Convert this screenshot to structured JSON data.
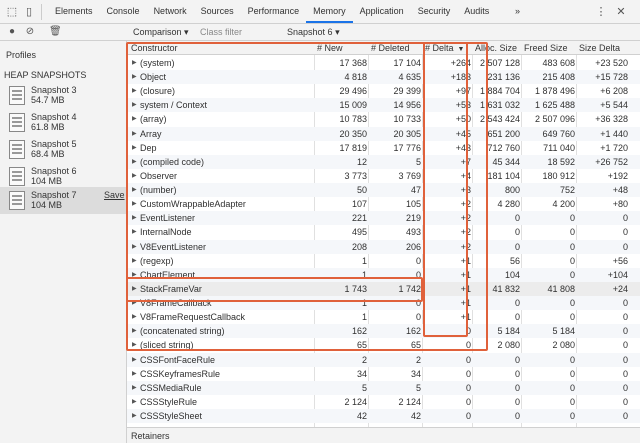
{
  "tabs": [
    "Elements",
    "Console",
    "Network",
    "Sources",
    "Performance",
    "Memory",
    "Application",
    "Security",
    "Audits"
  ],
  "active_tab": "Memory",
  "more_tabs_label": "»",
  "toolbar": {
    "view_select": "Comparison",
    "view_caret": "▾",
    "filter_placeholder": "Class filter",
    "base_snapshot": "Snapshot 6",
    "base_caret": "▾"
  },
  "sidebar": {
    "profiles_label": "Profiles",
    "section_label": "HEAP SNAPSHOTS",
    "snapshots": [
      {
        "name": "Snapshot 3",
        "size": "54.7 MB"
      },
      {
        "name": "Snapshot 4",
        "size": "61.8 MB"
      },
      {
        "name": "Snapshot 5",
        "size": "68.4 MB"
      },
      {
        "name": "Snapshot 6",
        "size": "104 MB"
      },
      {
        "name": "Snapshot 7",
        "size": "104 MB",
        "save": "Save"
      }
    ],
    "selected_snapshot": "Snapshot 7"
  },
  "table": {
    "columns": [
      "Constructor",
      "# New",
      "# Deleted",
      "# Delta",
      "Alloc. Size",
      "Freed Size",
      "Size Delta"
    ],
    "sort_indicator": "▼",
    "expand_glyph": "▶",
    "rows": [
      {
        "name": "(system)",
        "new": "17 368",
        "deleted": "17 104",
        "delta": "+264",
        "alloc": "2 507 128",
        "freed": "483 608",
        "sizedelta": "+23 520"
      },
      {
        "name": "Object",
        "new": "4 818",
        "deleted": "4 635",
        "delta": "+183",
        "alloc": "231 136",
        "freed": "215 408",
        "sizedelta": "+15 728"
      },
      {
        "name": "(closure)",
        "new": "29 496",
        "deleted": "29 399",
        "delta": "+97",
        "alloc": "1 884 704",
        "freed": "1 878 496",
        "sizedelta": "+6 208"
      },
      {
        "name": "system / Context",
        "new": "15 009",
        "deleted": "14 956",
        "delta": "+53",
        "alloc": "1 631 032",
        "freed": "1 625 488",
        "sizedelta": "+5 544"
      },
      {
        "name": "(array)",
        "new": "10 783",
        "deleted": "10 733",
        "delta": "+50",
        "alloc": "2 543 424",
        "freed": "2 507 096",
        "sizedelta": "+36 328"
      },
      {
        "name": "Array",
        "new": "20 350",
        "deleted": "20 305",
        "delta": "+45",
        "alloc": "651 200",
        "freed": "649 760",
        "sizedelta": "+1 440"
      },
      {
        "name": "Dep",
        "new": "17 819",
        "deleted": "17 776",
        "delta": "+43",
        "alloc": "712 760",
        "freed": "711 040",
        "sizedelta": "+1 720"
      },
      {
        "name": "(compiled code)",
        "new": "12",
        "deleted": "5",
        "delta": "+7",
        "alloc": "45 344",
        "freed": "18 592",
        "sizedelta": "+26 752"
      },
      {
        "name": "Observer",
        "new": "3 773",
        "deleted": "3 769",
        "delta": "+4",
        "alloc": "181 104",
        "freed": "180 912",
        "sizedelta": "+192"
      },
      {
        "name": "(number)",
        "new": "50",
        "deleted": "47",
        "delta": "+3",
        "alloc": "800",
        "freed": "752",
        "sizedelta": "+48"
      },
      {
        "name": "CustomWrappableAdapter",
        "new": "107",
        "deleted": "105",
        "delta": "+2",
        "alloc": "4 280",
        "freed": "4 200",
        "sizedelta": "+80"
      },
      {
        "name": "EventListener",
        "new": "221",
        "deleted": "219",
        "delta": "+2",
        "alloc": "0",
        "freed": "0",
        "sizedelta": "0"
      },
      {
        "name": "InternalNode",
        "new": "495",
        "deleted": "493",
        "delta": "+2",
        "alloc": "0",
        "freed": "0",
        "sizedelta": "0"
      },
      {
        "name": "V8EventListener",
        "new": "208",
        "deleted": "206",
        "delta": "+2",
        "alloc": "0",
        "freed": "0",
        "sizedelta": "0"
      },
      {
        "name": "(regexp)",
        "new": "1",
        "deleted": "0",
        "delta": "+1",
        "alloc": "56",
        "freed": "0",
        "sizedelta": "+56"
      },
      {
        "name": "ChartElement",
        "new": "1",
        "deleted": "0",
        "delta": "+1",
        "alloc": "104",
        "freed": "0",
        "sizedelta": "+104"
      },
      {
        "name": "StackFrameVar",
        "new": "1 743",
        "deleted": "1 742",
        "delta": "+1",
        "alloc": "41 832",
        "freed": "41 808",
        "sizedelta": "+24"
      },
      {
        "name": "V8FrameCallback",
        "new": "1",
        "deleted": "0",
        "delta": "+1",
        "alloc": "0",
        "freed": "0",
        "sizedelta": "0"
      },
      {
        "name": "V8FrameRequestCallback",
        "new": "1",
        "deleted": "0",
        "delta": "+1",
        "alloc": "0",
        "freed": "0",
        "sizedelta": "0"
      },
      {
        "name": "(concatenated string)",
        "new": "162",
        "deleted": "162",
        "delta": "0",
        "alloc": "5 184",
        "freed": "5 184",
        "sizedelta": "0"
      },
      {
        "name": "(sliced string)",
        "new": "65",
        "deleted": "65",
        "delta": "0",
        "alloc": "2 080",
        "freed": "2 080",
        "sizedelta": "0"
      },
      {
        "name": "CSSFontFaceRule",
        "new": "2",
        "deleted": "2",
        "delta": "0",
        "alloc": "0",
        "freed": "0",
        "sizedelta": "0"
      },
      {
        "name": "CSSKeyframesRule",
        "new": "34",
        "deleted": "34",
        "delta": "0",
        "alloc": "0",
        "freed": "0",
        "sizedelta": "0"
      },
      {
        "name": "CSSMediaRule",
        "new": "5",
        "deleted": "5",
        "delta": "0",
        "alloc": "0",
        "freed": "0",
        "sizedelta": "0"
      },
      {
        "name": "CSSStyleRule",
        "new": "2 124",
        "deleted": "2 124",
        "delta": "0",
        "alloc": "0",
        "freed": "0",
        "sizedelta": "0"
      },
      {
        "name": "CSSStyleSheet",
        "new": "42",
        "deleted": "42",
        "delta": "0",
        "alloc": "0",
        "freed": "0",
        "sizedelta": "0"
      }
    ],
    "selected_row": "StackFrameVar"
  },
  "bottom_panel_label": "Retainers",
  "colors": {
    "annotation": "#e0613b",
    "accent": "#1a73e8"
  }
}
